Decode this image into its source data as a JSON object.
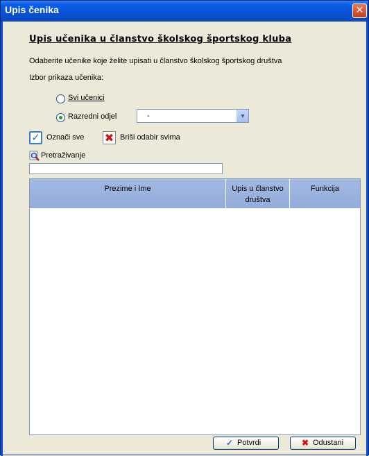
{
  "window": {
    "title": "Upis čenika",
    "close_glyph": "✕"
  },
  "form": {
    "heading": "Upis učenika u članstvo školskog športskog kluba",
    "instruction": "Odaberite učenike koje želite upisati u članstvo školskog športskog društva",
    "display_choice_label": "Izbor prikaza učenika:",
    "radio_all": {
      "label": "Svi učenici",
      "checked": false
    },
    "radio_class": {
      "label": "Razredni odjel",
      "checked": true
    },
    "class_combo": {
      "value": "-",
      "arrow_glyph": "▼"
    },
    "select_all": {
      "label": "Označi sve",
      "icon": "checkmark-icon",
      "glyph": "✓"
    },
    "clear_selection": {
      "label": "Briši odabir svima",
      "icon": "red-x-icon",
      "glyph": "✖"
    },
    "search": {
      "label": "Pretraživanje",
      "icon": "magnifier-icon",
      "value": ""
    }
  },
  "grid": {
    "columns": [
      {
        "label": "Prezime i Ime"
      },
      {
        "label": "Upis u članstvo društva"
      },
      {
        "label": "Funkcija"
      }
    ],
    "rows": []
  },
  "footer": {
    "confirm": {
      "label": "Potvrdi",
      "icon": "checkmark-icon",
      "glyph": "✓",
      "color": "#2a6fb8"
    },
    "cancel": {
      "label": "Odustani",
      "icon": "red-x-icon",
      "glyph": "✖",
      "color": "#d01010"
    }
  },
  "colors": {
    "titlebar": "#0852d6",
    "grid_header": "#9bb3de",
    "window_bg": "#ece9d8"
  }
}
